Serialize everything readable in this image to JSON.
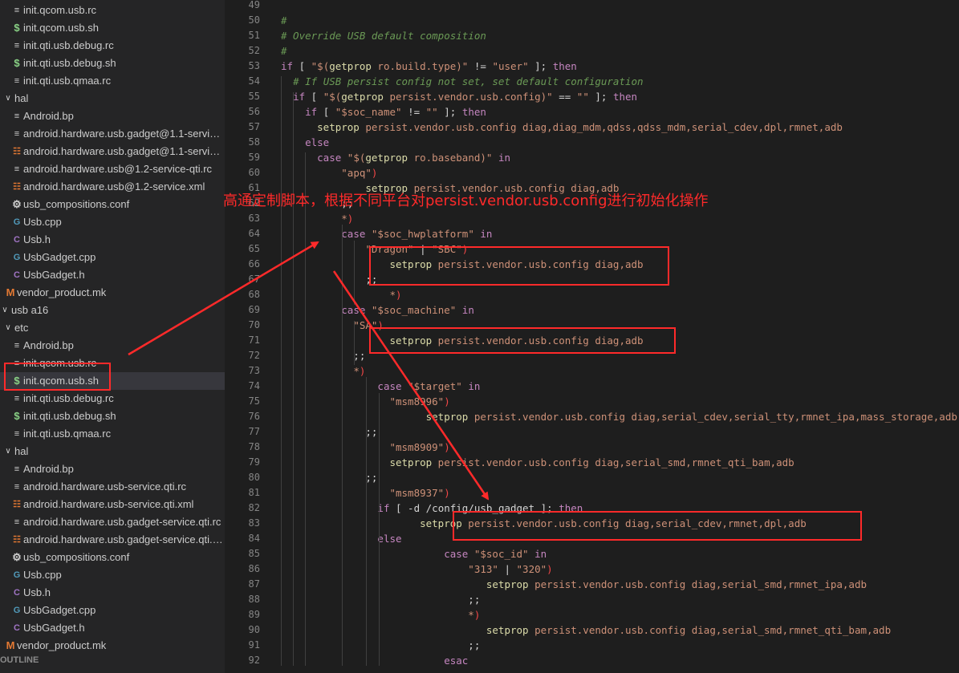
{
  "sidebar": {
    "items": [
      {
        "label": "init.qcom.usb.rc",
        "icon": "lines-icon",
        "depth": 2
      },
      {
        "label": "init.qcom.usb.sh",
        "icon": "dollar-icon",
        "depth": 2
      },
      {
        "label": "init.qti.usb.debug.rc",
        "icon": "lines-icon",
        "depth": 2
      },
      {
        "label": "init.qti.usb.debug.sh",
        "icon": "dollar-icon",
        "depth": 2
      },
      {
        "label": "init.qti.usb.qmaa.rc",
        "icon": "lines-icon",
        "depth": 2
      },
      {
        "label": "hal",
        "icon": "chevron-down-icon",
        "depth": 1,
        "folder": true
      },
      {
        "label": "Android.bp",
        "icon": "lines-icon",
        "depth": 2
      },
      {
        "label": "android.hardware.usb.gadget@1.1-service...",
        "icon": "lines-icon",
        "depth": 2
      },
      {
        "label": "android.hardware.usb.gadget@1.1-service...",
        "icon": "rss-icon",
        "depth": 2
      },
      {
        "label": "android.hardware.usb@1.2-service-qti.rc",
        "icon": "lines-icon",
        "depth": 2
      },
      {
        "label": "android.hardware.usb@1.2-service.xml",
        "icon": "rss-icon",
        "depth": 2
      },
      {
        "label": "usb_compositions.conf",
        "icon": "gear-icon",
        "depth": 2
      },
      {
        "label": "Usb.cpp",
        "icon": "cpp-icon",
        "depth": 2
      },
      {
        "label": "Usb.h",
        "icon": "h-icon",
        "depth": 2
      },
      {
        "label": "UsbGadget.cpp",
        "icon": "cpp-icon",
        "depth": 2
      },
      {
        "label": "UsbGadget.h",
        "icon": "h-icon",
        "depth": 2
      },
      {
        "label": "vendor_product.mk",
        "icon": "makefile-icon",
        "depth": 1
      },
      {
        "label": "usb a16",
        "icon": "chevron-down-icon",
        "depth": 0,
        "folder": true
      },
      {
        "label": "etc",
        "icon": "chevron-down-icon",
        "depth": 1,
        "folder": true
      },
      {
        "label": "Android.bp",
        "icon": "lines-icon",
        "depth": 2
      },
      {
        "label": "init.qcom.usb.rc",
        "icon": "lines-icon",
        "depth": 2
      },
      {
        "label": "init.qcom.usb.sh",
        "icon": "dollar-icon",
        "depth": 2,
        "selected": true
      },
      {
        "label": "init.qti.usb.debug.rc",
        "icon": "lines-icon",
        "depth": 2
      },
      {
        "label": "init.qti.usb.debug.sh",
        "icon": "dollar-icon",
        "depth": 2
      },
      {
        "label": "init.qti.usb.qmaa.rc",
        "icon": "lines-icon",
        "depth": 2
      },
      {
        "label": "hal",
        "icon": "chevron-down-icon",
        "depth": 1,
        "folder": true
      },
      {
        "label": "Android.bp",
        "icon": "lines-icon",
        "depth": 2
      },
      {
        "label": "android.hardware.usb-service.qti.rc",
        "icon": "lines-icon",
        "depth": 2
      },
      {
        "label": "android.hardware.usb-service.qti.xml",
        "icon": "rss-icon",
        "depth": 2
      },
      {
        "label": "android.hardware.usb.gadget-service.qti.rc",
        "icon": "lines-icon",
        "depth": 2
      },
      {
        "label": "android.hardware.usb.gadget-service.qti.x...",
        "icon": "rss-icon",
        "depth": 2
      },
      {
        "label": "usb_compositions.conf",
        "icon": "gear-icon",
        "depth": 2
      },
      {
        "label": "Usb.cpp",
        "icon": "cpp-icon",
        "depth": 2
      },
      {
        "label": "Usb.h",
        "icon": "h-icon",
        "depth": 2
      },
      {
        "label": "UsbGadget.cpp",
        "icon": "cpp-icon",
        "depth": 2
      },
      {
        "label": "UsbGadget.h",
        "icon": "h-icon",
        "depth": 2
      },
      {
        "label": "vendor_product.mk",
        "icon": "makefile-icon",
        "depth": 1
      }
    ],
    "outline_label": "OUTLINE"
  },
  "editor": {
    "line_numbers": [
      "49",
      "50",
      "51",
      "52",
      "53",
      "54",
      "55",
      "56",
      "57",
      "58",
      "59",
      "60",
      "61",
      "62",
      "63",
      "64",
      "65",
      "66",
      "67",
      "68",
      "69",
      "70",
      "71",
      "72",
      "73",
      "74",
      "75",
      "76",
      "77",
      "78",
      "79",
      "80",
      "81",
      "82",
      "83",
      "84",
      "85",
      "86",
      "87",
      "88",
      "89",
      "90",
      "91",
      "92"
    ],
    "lines": [
      [],
      [
        [
          "tk-comment",
          "#"
        ]
      ],
      [
        [
          "tk-comment",
          "# Override USB default composition"
        ]
      ],
      [
        [
          "tk-comment",
          "#"
        ]
      ],
      [
        [
          "tk-kw",
          "if"
        ],
        [
          "tk-plain",
          " [ "
        ],
        [
          "tk-str",
          "\"$("
        ],
        [
          "tk-cmd",
          "getprop"
        ],
        [
          "tk-str",
          " ro.build.type)\""
        ],
        [
          "tk-plain",
          " != "
        ],
        [
          "tk-str",
          "\"user\""
        ],
        [
          "tk-plain",
          " ]; "
        ],
        [
          "tk-kw",
          "then"
        ]
      ],
      [
        [
          "tk-plain",
          "  "
        ],
        [
          "tk-comment",
          "# If USB persist config not set, set default configuration"
        ]
      ],
      [
        [
          "tk-plain",
          "  "
        ],
        [
          "tk-kw",
          "if"
        ],
        [
          "tk-plain",
          " [ "
        ],
        [
          "tk-str",
          "\"$("
        ],
        [
          "tk-cmd",
          "getprop"
        ],
        [
          "tk-str",
          " persist.vendor.usb.config)\""
        ],
        [
          "tk-plain",
          " == "
        ],
        [
          "tk-str",
          "\"\""
        ],
        [
          "tk-plain",
          " ]; "
        ],
        [
          "tk-kw",
          "then"
        ]
      ],
      [
        [
          "tk-plain",
          "    "
        ],
        [
          "tk-kw",
          "if"
        ],
        [
          "tk-plain",
          " [ "
        ],
        [
          "tk-str",
          "\"$soc_name\""
        ],
        [
          "tk-plain",
          " != "
        ],
        [
          "tk-str",
          "\"\""
        ],
        [
          "tk-plain",
          " ]; "
        ],
        [
          "tk-kw",
          "then"
        ]
      ],
      [
        [
          "tk-plain",
          "      "
        ],
        [
          "tk-cmd",
          "setprop"
        ],
        [
          "tk-str",
          " persist.vendor.usb.config diag,diag_mdm,qdss,qdss_mdm,serial_cdev,dpl,rmnet,adb"
        ]
      ],
      [
        [
          "tk-plain",
          "    "
        ],
        [
          "tk-kw",
          "else"
        ]
      ],
      [
        [
          "tk-plain",
          "      "
        ],
        [
          "tk-kw",
          "case"
        ],
        [
          "tk-plain",
          " "
        ],
        [
          "tk-str",
          "\"$("
        ],
        [
          "tk-cmd",
          "getprop"
        ],
        [
          "tk-str",
          " ro.baseband)\""
        ],
        [
          "tk-plain",
          " "
        ],
        [
          "tk-kw",
          "in"
        ]
      ],
      [
        [
          "tk-plain",
          "          "
        ],
        [
          "tk-str",
          "\"apq\""
        ],
        [
          "tk-par",
          ")"
        ]
      ],
      [
        [
          "tk-plain",
          "              "
        ],
        [
          "tk-cmd",
          "setprop"
        ],
        [
          "tk-str",
          " persist.vendor.usb.config diag,adb"
        ]
      ],
      [
        [
          "tk-plain",
          "          ;;"
        ]
      ],
      [
        [
          "tk-plain",
          "          "
        ],
        [
          "tk-str",
          "*"
        ],
        [
          "tk-par",
          ")"
        ]
      ],
      [
        [
          "tk-plain",
          "          "
        ],
        [
          "tk-kw",
          "case"
        ],
        [
          "tk-plain",
          " "
        ],
        [
          "tk-str",
          "\"$soc_hwplatform\""
        ],
        [
          "tk-plain",
          " "
        ],
        [
          "tk-kw",
          "in"
        ]
      ],
      [
        [
          "tk-plain",
          "              "
        ],
        [
          "tk-str",
          "\"Dragon\""
        ],
        [
          "tk-plain",
          " | "
        ],
        [
          "tk-str",
          "\"SBC\""
        ],
        [
          "tk-par",
          ")"
        ]
      ],
      [
        [
          "tk-plain",
          "                  "
        ],
        [
          "tk-cmd",
          "setprop"
        ],
        [
          "tk-str",
          " persist.vendor.usb.config diag,adb"
        ]
      ],
      [
        [
          "tk-plain",
          "              ;;"
        ]
      ],
      [
        [
          "tk-plain",
          "                  "
        ],
        [
          "tk-str",
          "*"
        ],
        [
          "tk-par",
          ")"
        ]
      ],
      [
        [
          "tk-plain",
          "          "
        ],
        [
          "tk-kw",
          "case"
        ],
        [
          "tk-plain",
          " "
        ],
        [
          "tk-str",
          "\"$soc_machine\""
        ],
        [
          "tk-plain",
          " "
        ],
        [
          "tk-kw",
          "in"
        ]
      ],
      [
        [
          "tk-plain",
          "            "
        ],
        [
          "tk-str",
          "\"SA\""
        ],
        [
          "tk-par",
          ")"
        ]
      ],
      [
        [
          "tk-plain",
          "                  "
        ],
        [
          "tk-cmd",
          "setprop"
        ],
        [
          "tk-str",
          " persist.vendor.usb.config diag,adb"
        ]
      ],
      [
        [
          "tk-plain",
          "            ;;"
        ]
      ],
      [
        [
          "tk-plain",
          "            "
        ],
        [
          "tk-str",
          "*"
        ],
        [
          "tk-par",
          ")"
        ]
      ],
      [
        [
          "tk-plain",
          "                "
        ],
        [
          "tk-kw",
          "case"
        ],
        [
          "tk-plain",
          " "
        ],
        [
          "tk-str",
          "\"$target\""
        ],
        [
          "tk-plain",
          " "
        ],
        [
          "tk-kw",
          "in"
        ]
      ],
      [
        [
          "tk-plain",
          "                  "
        ],
        [
          "tk-str",
          "\"msm8996\""
        ],
        [
          "tk-par",
          ")"
        ]
      ],
      [
        [
          "tk-plain",
          "                        "
        ],
        [
          "tk-cmd",
          "setprop"
        ],
        [
          "tk-str",
          " persist.vendor.usb.config diag,serial_cdev,serial_tty,rmnet_ipa,mass_storage,adb"
        ]
      ],
      [
        [
          "tk-plain",
          "              ;;"
        ]
      ],
      [
        [
          "tk-plain",
          "                  "
        ],
        [
          "tk-str",
          "\"msm8909\""
        ],
        [
          "tk-par",
          ")"
        ]
      ],
      [
        [
          "tk-plain",
          "                  "
        ],
        [
          "tk-cmd",
          "setprop"
        ],
        [
          "tk-str",
          " persist.vendor.usb.config diag,serial_smd,rmnet_qti_bam,adb"
        ]
      ],
      [
        [
          "tk-plain",
          "              ;;"
        ]
      ],
      [
        [
          "tk-plain",
          "                  "
        ],
        [
          "tk-str",
          "\"msm8937\""
        ],
        [
          "tk-par",
          ")"
        ]
      ],
      [
        [
          "tk-plain",
          "                "
        ],
        [
          "tk-kw",
          "if"
        ],
        [
          "tk-plain",
          " [ -d /config/usb_gadget ]; "
        ],
        [
          "tk-kw",
          "then"
        ]
      ],
      [
        [
          "tk-plain",
          "                       "
        ],
        [
          "tk-cmd",
          "setprop"
        ],
        [
          "tk-str",
          " persist.vendor.usb.config diag,serial_cdev,rmnet,dpl,adb"
        ]
      ],
      [
        [
          "tk-plain",
          "                "
        ],
        [
          "tk-kw",
          "else"
        ]
      ],
      [
        [
          "tk-plain",
          "                           "
        ],
        [
          "tk-kw",
          "case"
        ],
        [
          "tk-plain",
          " "
        ],
        [
          "tk-str",
          "\"$soc_id\""
        ],
        [
          "tk-plain",
          " "
        ],
        [
          "tk-kw",
          "in"
        ]
      ],
      [
        [
          "tk-plain",
          "                               "
        ],
        [
          "tk-str",
          "\"313\""
        ],
        [
          "tk-plain",
          " | "
        ],
        [
          "tk-str",
          "\"320\""
        ],
        [
          "tk-par",
          ")"
        ]
      ],
      [
        [
          "tk-plain",
          "                                  "
        ],
        [
          "tk-cmd",
          "setprop"
        ],
        [
          "tk-str",
          " persist.vendor.usb.config diag,serial_smd,rmnet_ipa,adb"
        ]
      ],
      [
        [
          "tk-plain",
          "                               ;;"
        ]
      ],
      [
        [
          "tk-plain",
          "                               "
        ],
        [
          "tk-str",
          "*"
        ],
        [
          "tk-par",
          ")"
        ]
      ],
      [
        [
          "tk-plain",
          "                                  "
        ],
        [
          "tk-cmd",
          "setprop"
        ],
        [
          "tk-str",
          " persist.vendor.usb.config diag,serial_smd,rmnet_qti_bam,adb"
        ]
      ],
      [
        [
          "tk-plain",
          "                               ;;"
        ]
      ],
      [
        [
          "tk-plain",
          "                           "
        ],
        [
          "tk-kw",
          "esac"
        ]
      ]
    ]
  },
  "annotation": {
    "text": "高通定制脚本，根据不同平台对persist.vendor.usb.config进行初始化操作",
    "color": "#ff2a2a"
  },
  "colors": {
    "comment": "#6a9955",
    "keyword": "#c586c0",
    "string": "#ce9178",
    "command": "#dcdcaa",
    "annotation": "#ff2a2a"
  }
}
